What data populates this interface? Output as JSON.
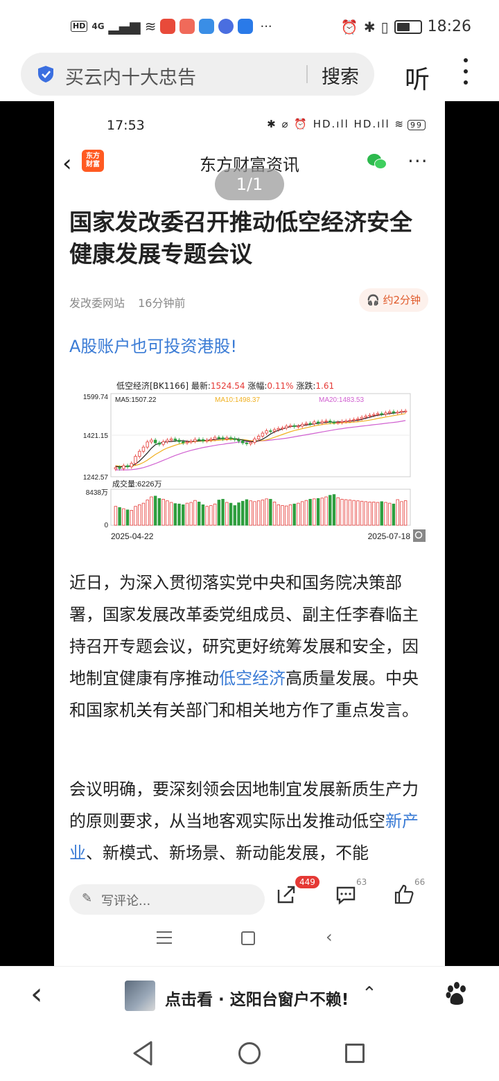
{
  "status_bar": {
    "hd": "HD",
    "signal": "4G",
    "time": "18:26",
    "more_icons": "···"
  },
  "search_bar": {
    "query": "买云内十大忠告",
    "search_button": "搜索",
    "listen_button": "听"
  },
  "inner_screenshot": {
    "status_time": "17:53",
    "status_icons": "✱ ⌀ ⏰ HD.ıll HD.ıll ≋",
    "battery": "99",
    "header_title": "东方财富资讯",
    "logo_text": [
      "东方",
      "财富"
    ],
    "pager": "1/1",
    "more": "···"
  },
  "article": {
    "title": "国家发改委召开推动低空经济安全健康发展专题会议",
    "source": "发改委网站",
    "time_ago": "16分钟前",
    "read_time": "约2分钟",
    "promo": "A股账户也可投资港股!",
    "paragraph1_before_link": "近日，为深入贯彻落实党中央和国务院决策部署，国家发展改革委党组成员、副主任李春临主持召开专题会议，研究更好统筹发展和安全，因地制宜健康有序推动",
    "paragraph1_link": "低空经济",
    "paragraph1_after_link": "高质量发展。中央和国家机关有关部门和相关地方作了重点发言。",
    "paragraph2_before_link": "会议明确，要深刻领会因地制宜发展新质生产力的原则要求，从当地客观实际出发推动低空",
    "paragraph2_link": "新产业",
    "paragraph2_after_link": "、新模式、新场景、新动能发展，不能"
  },
  "chart_data": {
    "type": "candlestick",
    "title": "低空经济[BK1166]",
    "latest_label": "最新:",
    "latest_value": "1524.54",
    "change_pct_label": "涨幅:",
    "change_pct": "0.11%",
    "change_label": "涨跌:",
    "change": "1.61",
    "ma5_label": "MA5:1507.22",
    "ma10_label": "MA10:1498.37",
    "ma20_label": "MA20:1483.53",
    "y_ticks": [
      "1599.74",
      "1421.15",
      "1242.57"
    ],
    "ylim": [
      1242.57,
      1599.74
    ],
    "volume_label": "成交量:6226万",
    "volume_ticks": [
      "8438万",
      "0"
    ],
    "x_start": "2025-04-22",
    "x_end": "2025-07-18",
    "series": [
      {
        "name": "close",
        "values": [
          1282,
          1278,
          1290,
          1285,
          1300,
          1330,
          1352,
          1370,
          1392,
          1400,
          1388,
          1382,
          1393,
          1400,
          1405,
          1400,
          1393,
          1388,
          1392,
          1395,
          1403,
          1402,
          1396,
          1400,
          1404,
          1412,
          1410,
          1405,
          1410,
          1407,
          1402,
          1396,
          1388,
          1384,
          1390,
          1405,
          1417,
          1430,
          1440,
          1438,
          1445,
          1450,
          1452,
          1460,
          1462,
          1458,
          1460,
          1468,
          1472,
          1470,
          1478,
          1474,
          1480,
          1482,
          1477,
          1475,
          1476,
          1480,
          1482,
          1485,
          1488,
          1492,
          1498,
          1503,
          1507,
          1510,
          1514,
          1511,
          1517,
          1522,
          1518,
          1520,
          1524,
          1525
        ]
      },
      {
        "name": "MA5",
        "values": [
          1287,
          1285,
          1286,
          1287,
          1290,
          1297,
          1310,
          1327,
          1345,
          1365,
          1380,
          1386,
          1391,
          1393,
          1394,
          1396,
          1398,
          1397,
          1395,
          1394,
          1396,
          1397,
          1398,
          1399,
          1401,
          1403,
          1405,
          1406,
          1407,
          1407,
          1406,
          1404,
          1400,
          1397,
          1394,
          1393,
          1397,
          1404,
          1414,
          1426,
          1435,
          1442,
          1448,
          1453,
          1458,
          1460,
          1461,
          1463,
          1465,
          1467,
          1470,
          1472,
          1474,
          1476,
          1477,
          1477,
          1478,
          1479,
          1480,
          1481,
          1483,
          1485,
          1489,
          1494,
          1498,
          1503,
          1507,
          1509,
          1511,
          1514,
          1516,
          1518,
          1520,
          1522
        ]
      },
      {
        "name": "MA10",
        "values": [
          1290,
          1288,
          1287,
          1287,
          1288,
          1291,
          1296,
          1304,
          1314,
          1326,
          1338,
          1348,
          1358,
          1366,
          1372,
          1378,
          1383,
          1387,
          1390,
          1392,
          1394,
          1395,
          1396,
          1396,
          1397,
          1398,
          1399,
          1401,
          1402,
          1403,
          1403,
          1403,
          1402,
          1400,
          1398,
          1397,
          1397,
          1398,
          1401,
          1406,
          1412,
          1418,
          1424,
          1430,
          1436,
          1441,
          1445,
          1449,
          1453,
          1457,
          1461,
          1464,
          1467,
          1469,
          1471,
          1472,
          1473,
          1474,
          1475,
          1476,
          1477,
          1479,
          1481,
          1483,
          1486,
          1489,
          1493,
          1496,
          1499,
          1502,
          1505,
          1508,
          1511,
          1514
        ]
      },
      {
        "name": "MA20",
        "values": [
          1272,
          1272,
          1272,
          1272,
          1273,
          1275,
          1278,
          1282,
          1287,
          1293,
          1299,
          1306,
          1313,
          1320,
          1327,
          1334,
          1340,
          1346,
          1351,
          1356,
          1360,
          1364,
          1368,
          1371,
          1374,
          1377,
          1380,
          1382,
          1385,
          1387,
          1389,
          1391,
          1392,
          1393,
          1394,
          1395,
          1396,
          1397,
          1398,
          1400,
          1402,
          1404,
          1406,
          1408,
          1411,
          1414,
          1417,
          1420,
          1423,
          1426,
          1429,
          1432,
          1435,
          1438,
          1441,
          1444,
          1447,
          1449,
          1452,
          1454,
          1456,
          1458,
          1460,
          1462,
          1464,
          1466,
          1468,
          1470,
          1472,
          1474,
          1476,
          1478,
          1481,
          1484
        ]
      }
    ],
    "volume_series": [
      {
        "name": "volume",
        "values": [
          4800,
          4500,
          4200,
          3900,
          3800,
          4800,
          5200,
          5600,
          6400,
          7200,
          7400,
          6800,
          6600,
          6200,
          5800,
          5500,
          5400,
          5200,
          5600,
          5800,
          6300,
          5900,
          5200,
          4800,
          5000,
          5400,
          6400,
          6600,
          5800,
          5600,
          5000,
          5700,
          6100,
          6500,
          6200,
          6000,
          6200,
          6400,
          6700,
          6600,
          5900,
          5200,
          5000,
          4900,
          5200,
          5400,
          5600,
          6000,
          6300,
          6600,
          6700,
          6800,
          6900,
          7200,
          7600,
          7800,
          7000,
          6600,
          6500,
          6400,
          6300,
          6200,
          6100,
          6000,
          5900,
          5900,
          5800,
          6000,
          5800,
          5600,
          5400,
          6500,
          6000,
          6226
        ]
      },
      {
        "name": "up_flags",
        "values": [
          1,
          0,
          1,
          0,
          1,
          1,
          1,
          1,
          1,
          1,
          0,
          0,
          1,
          1,
          1,
          0,
          0,
          0,
          1,
          1,
          1,
          0,
          0,
          1,
          1,
          1,
          0,
          0,
          1,
          0,
          0,
          0,
          0,
          0,
          1,
          1,
          1,
          1,
          1,
          0,
          1,
          1,
          1,
          1,
          1,
          0,
          1,
          1,
          1,
          0,
          1,
          0,
          1,
          1,
          0,
          0,
          1,
          1,
          1,
          1,
          1,
          1,
          1,
          1,
          1,
          1,
          1,
          0,
          1,
          1,
          0,
          1,
          1,
          1
        ]
      }
    ],
    "colors": {
      "up": "#e53935",
      "down": "#2e9e3e",
      "ma5": "#222222",
      "ma10": "#f0b020",
      "ma20": "#d060d0"
    }
  },
  "bottom_actions": {
    "comment_placeholder": "写评论...",
    "share_count": "449",
    "comment_count": "63",
    "like_count": "66"
  },
  "outer_bottom": {
    "recommend_text": "点击看 · 这阳台窗户不赖!",
    "up_arrow": "⌃"
  }
}
